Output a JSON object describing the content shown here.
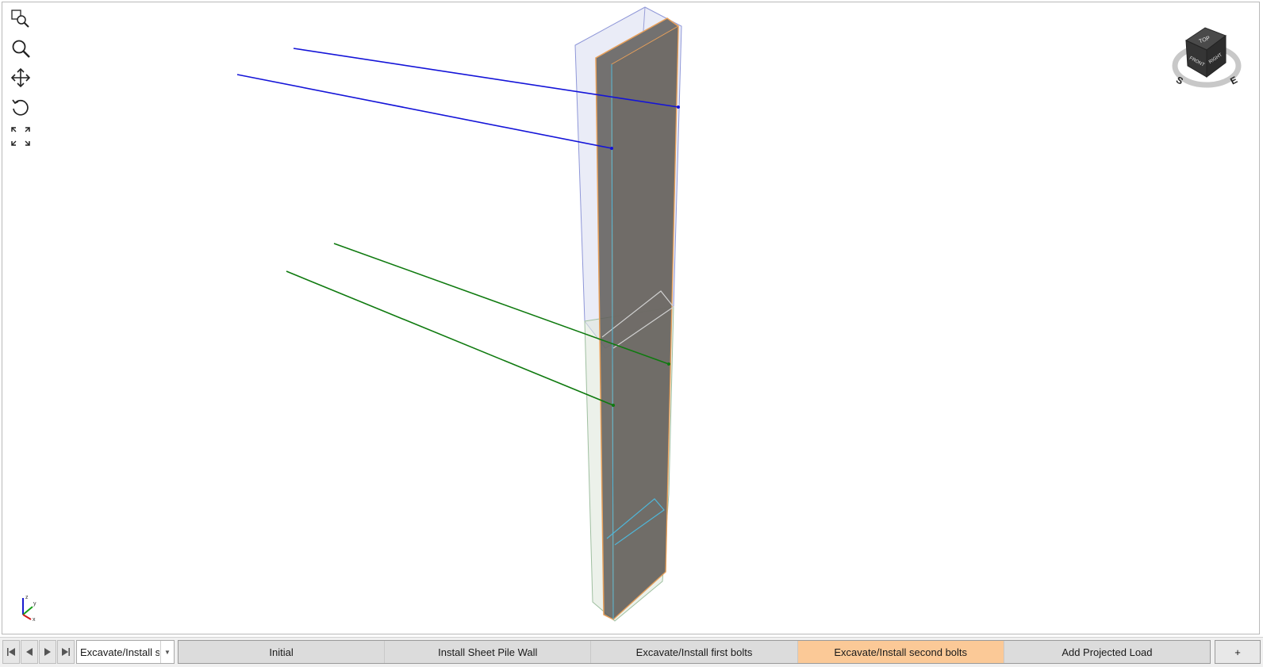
{
  "toolbar": {
    "tools": [
      {
        "name": "zoom-window-icon"
      },
      {
        "name": "zoom-icon"
      },
      {
        "name": "pan-icon"
      },
      {
        "name": "rotate-icon"
      },
      {
        "name": "zoom-extents-icon"
      }
    ]
  },
  "view_cube": {
    "top_label": "TOP",
    "front_label": "FRONT",
    "right_label": "RIGHT",
    "compass_s": "S",
    "compass_e": "E"
  },
  "axis_triad": {
    "z": "z",
    "y": "y",
    "x": "x"
  },
  "stage_bar": {
    "current_stage": "Excavate/Install se",
    "tabs": [
      {
        "label": "Initial",
        "active": false
      },
      {
        "label": "Install Sheet Pile Wall",
        "active": false
      },
      {
        "label": "Excavate/Install first bolts",
        "active": false
      },
      {
        "label": "Excavate/Install second bolts",
        "active": true
      },
      {
        "label": "Add Projected Load",
        "active": false
      }
    ],
    "add_label": "+"
  },
  "colors": {
    "first_bolts": "#1414d8",
    "second_bolts": "#0f7a0f",
    "wall_edge": "#e8a05a",
    "active_tab": "#fbc997"
  }
}
